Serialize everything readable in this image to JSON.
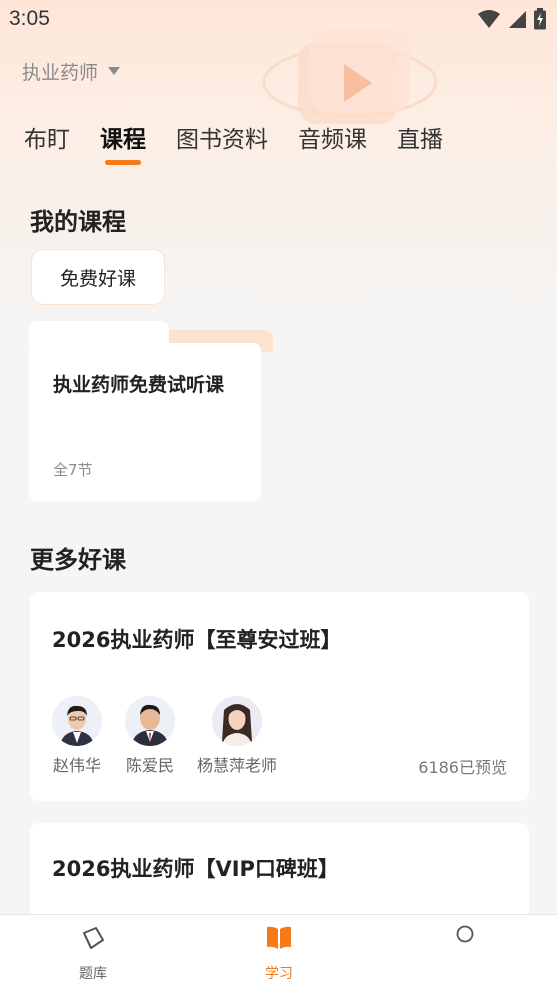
{
  "status_bar": {
    "time": "3:05"
  },
  "header": {
    "selector_label": "执业药师"
  },
  "tabs": [
    {
      "label": "布盯"
    },
    {
      "label": "课程",
      "active": true
    },
    {
      "label": "图书资料"
    },
    {
      "label": "音频课"
    },
    {
      "label": "直播"
    }
  ],
  "my_courses": {
    "title": "我的课程",
    "chip_label": "免费好课",
    "folder": {
      "title": "执业药师免费试听课",
      "lesson_count": "全7节"
    }
  },
  "more_courses": {
    "title": "更多好课",
    "cards": [
      {
        "title": "2026执业药师【至尊安过班】",
        "teachers": [
          {
            "name": "赵伟华"
          },
          {
            "name": "陈爱民"
          },
          {
            "name": "杨慧萍老师"
          }
        ],
        "views": "6186已预览"
      },
      {
        "title": "2026执业药师【VIP口碑班】"
      }
    ]
  },
  "bottom_nav": [
    {
      "label": "题库",
      "icon": "question-bank-icon"
    },
    {
      "label": "学习",
      "icon": "book-icon",
      "active": true
    },
    {
      "label": "",
      "icon": "profile-icon"
    }
  ],
  "colors": {
    "accent": "#f47a1a",
    "background": "#f5f5f5",
    "header_gradient": "#fde6d8"
  }
}
